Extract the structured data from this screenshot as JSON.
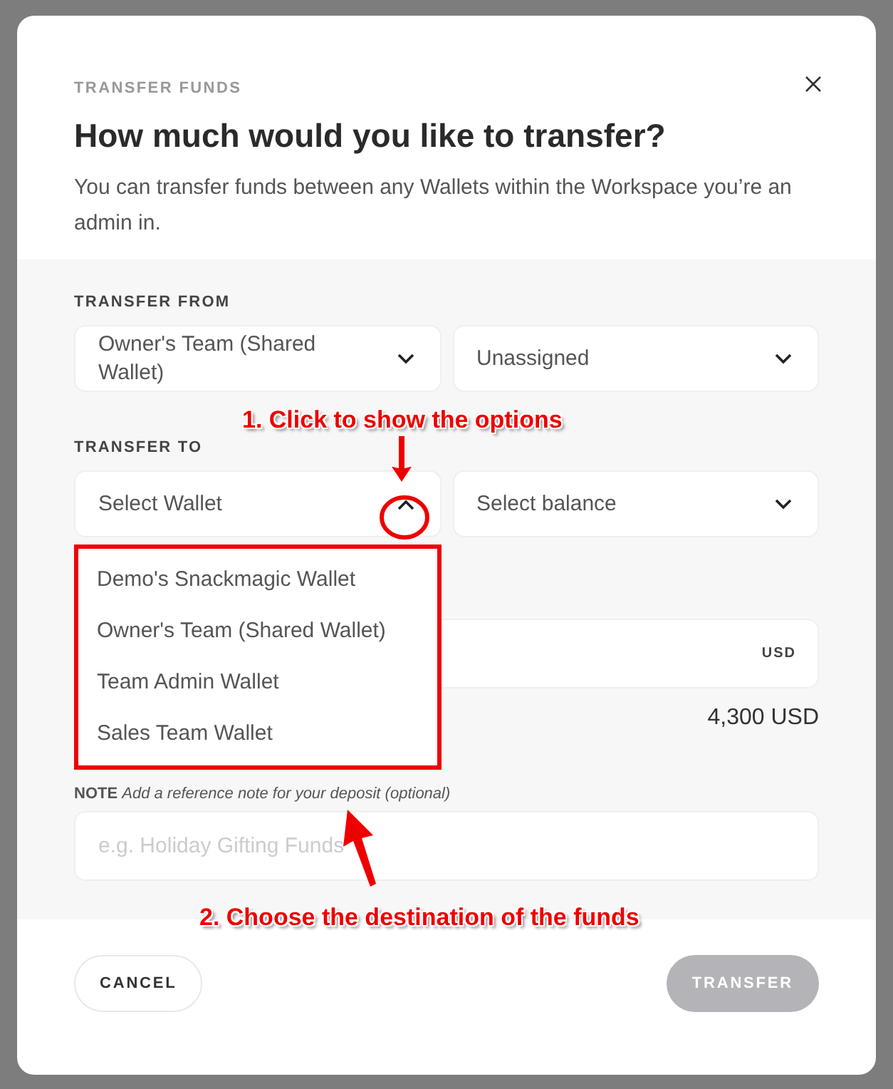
{
  "modal": {
    "eyebrow": "TRANSFER FUNDS",
    "title": "How much would you like to transfer?",
    "description": "You can transfer funds between any Wallets within the Workspace you’re an admin in."
  },
  "transfer_from": {
    "label": "TRANSFER FROM",
    "wallet": "Owner's Team (Shared Wallet)",
    "balance": "Unassigned"
  },
  "transfer_to": {
    "label": "TRANSFER TO",
    "wallet_placeholder": "Select Wallet",
    "balance_placeholder": "Select balance",
    "expanded": true
  },
  "wallet_options": [
    "Demo's Snackmagic Wallet",
    "Owner's Team (Shared Wallet)",
    "Team Admin Wallet",
    "Sales Team Wallet"
  ],
  "amount": {
    "currency": "USD",
    "available": "4,300 USD"
  },
  "note": {
    "label": "NOTE",
    "hint": "Add a reference note for your deposit (optional)",
    "placeholder": "e.g. Holiday Gifting Funds"
  },
  "buttons": [
    {
      "label": "CANCEL",
      "kind": "secondary",
      "disabled": false
    },
    {
      "label": "TRANSFER",
      "kind": "primary",
      "disabled": true
    }
  ],
  "annotations": [
    {
      "kind": "step-one",
      "text": "1. Click to show the options"
    },
    {
      "kind": "step-two",
      "text": "2. Choose the destination of the funds"
    }
  ]
}
